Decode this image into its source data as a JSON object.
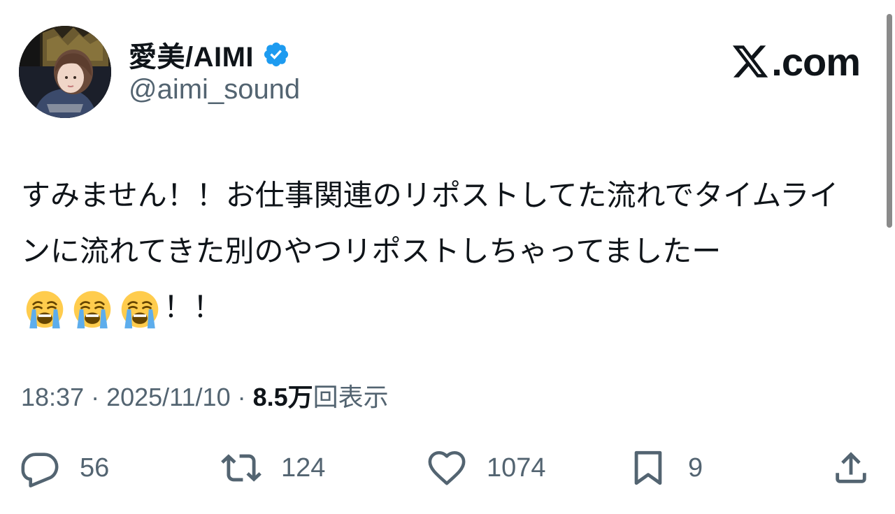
{
  "author": {
    "display_name": "愛美/AIMI",
    "handle": "@aimi_sound",
    "verified": true
  },
  "brand": {
    "domain": ".com"
  },
  "tweet": {
    "text_before_emoji": "すみません！！お仕事関連のリポストしてた流れでタイムラインに流れてきた別のやつリポストしちゃってましたー",
    "emoji": [
      "loudly-crying-face",
      "loudly-crying-face",
      "loudly-crying-face"
    ],
    "text_after_emoji": "！！"
  },
  "meta": {
    "time": "18:37",
    "separator": " · ",
    "date": "2025/11/10",
    "views_count": "8.5万",
    "views_label": "回表示"
  },
  "actions": {
    "reply_count": "56",
    "retweet_count": "124",
    "like_count": "1074",
    "bookmark_count": "9"
  },
  "colors": {
    "text_primary": "#0f1419",
    "text_secondary": "#536471",
    "verified_blue": "#1d9bf0",
    "background": "#ffffff"
  },
  "icons": {
    "reply": "reply-icon",
    "retweet": "retweet-icon",
    "like": "heart-icon",
    "bookmark": "bookmark-icon",
    "share": "share-icon",
    "verified": "verified-badge-icon",
    "logo": "x-logo-icon"
  }
}
